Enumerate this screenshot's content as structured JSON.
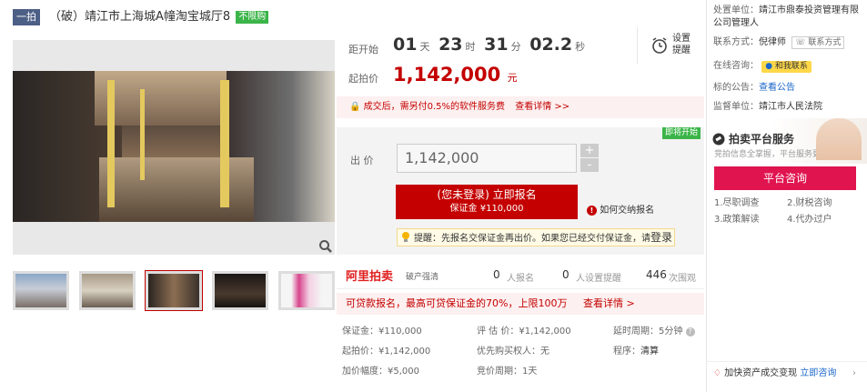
{
  "header": {
    "tag": "一拍",
    "title": "（破）靖江市上海城A幢淘宝城厅8",
    "badge": "不限购"
  },
  "auction": {
    "countdown_label": "距开始",
    "days": "01",
    "days_unit": "天",
    "hours": "23",
    "hours_unit": "时",
    "minutes": "31",
    "minutes_unit": "分",
    "seconds": "02.2",
    "seconds_unit": "秒",
    "start_price_label": "起拍价",
    "start_price": "1,142,000",
    "price_unit": "元",
    "remind_label": "设置提醒",
    "fee_notice": "成交后，需另付0.5%的软件服务费",
    "fee_link": "查看详情 >>",
    "green_tag": "即将开始",
    "bid_label": "出 价",
    "bid_value": "1,142,000",
    "plus": "+",
    "minus": "-",
    "signup_line1": "(您未登录) 立即报名",
    "signup_line2": "保证金 ¥110,000",
    "how_to": "如何交纳报名",
    "tip_text": "提醒：先报名交保证金再出价。如果您已经交付保证金，请",
    "tip_login": "登录"
  },
  "stats": {
    "brand": "阿里拍卖",
    "brand_sub": "破产强清",
    "applicants": "0",
    "applicants_label": "人报名",
    "reminders": "0",
    "reminders_label": "人设置提醒",
    "views": "446",
    "views_label": "次围观"
  },
  "promo": {
    "text": "可贷款报名，最高可贷保证金的70%，上限100万",
    "link": "查看详情 >"
  },
  "details": {
    "deposit": "保证金：¥110,000",
    "start_price": "起拍价：¥1,142,000",
    "increment": "加价幅度：¥5,000",
    "assessed": "评 估 价：¥1,142,000",
    "priority": "优先购买权人：无",
    "cycle": "竞价周期：1天",
    "extension": "延时周期：5分钟",
    "procedure_label": "程序：",
    "procedure": "清算"
  },
  "right": {
    "unit_label": "处置单位：",
    "unit": "靖江市鼎泰投资管理有限公司管理人",
    "contact_label": "联系方式：",
    "contact_name": "倪律师",
    "contact_btn": "联系方式",
    "consult_label": "在线咨询：",
    "consult_btn": "和我联系",
    "notice_label": "标的公告：",
    "notice_link": "查看公告",
    "supervisor_label": "监督单位：",
    "supervisor": "靖江市人民法院",
    "service_title": "拍卖平台服务",
    "service_sub": "竞拍信息全掌握，平台服务更放心",
    "service_btn": "平台咨询",
    "service_items": [
      "1.尽职调查",
      "2.财税咨询",
      "3.政策解读",
      "4.代办过户"
    ],
    "footer_text": "加快资产成交变现",
    "footer_link": "立即咨询",
    "footer_arrow": "›"
  }
}
